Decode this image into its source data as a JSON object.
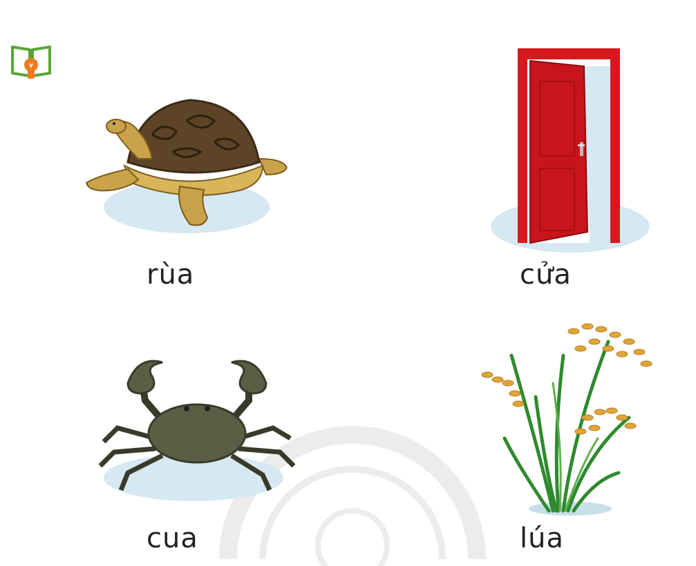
{
  "icons": {
    "lesson_icon": "book-lightbulb-icon"
  },
  "items": [
    {
      "word": "rùa",
      "picture": "turtle"
    },
    {
      "word": "cửa",
      "picture": "door"
    },
    {
      "word": "cua",
      "picture": "crab"
    },
    {
      "word": "lúa",
      "picture": "rice"
    }
  ],
  "colors": {
    "icon_green": "#62a83b",
    "icon_orange": "#ee7b21",
    "door_red": "#d8181f",
    "shadow_blue": "#d6e8f2"
  }
}
